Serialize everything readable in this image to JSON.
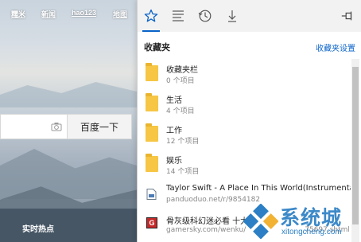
{
  "page": {
    "nav": [
      "糯米",
      "新闻",
      "hao123",
      "地图"
    ],
    "search_button": "百度一下",
    "hot_label": "实时热点"
  },
  "hub": {
    "tabs": [
      {
        "name": "favorites",
        "icon": "star-icon",
        "active": true
      },
      {
        "name": "reading-list",
        "icon": "reading-list-icon",
        "active": false
      },
      {
        "name": "history",
        "icon": "history-icon",
        "active": false
      },
      {
        "name": "downloads",
        "icon": "download-icon",
        "active": false
      }
    ],
    "pin_icon": "pin-icon",
    "title": "收藏夹",
    "settings_link": "收藏夹设置",
    "items": [
      {
        "type": "folder",
        "title": "收藏夹栏",
        "subtitle": "0 个项目"
      },
      {
        "type": "folder",
        "title": "生活",
        "subtitle": "4 个项目"
      },
      {
        "type": "folder",
        "title": "工作",
        "subtitle": "12 个项目"
      },
      {
        "type": "folder",
        "title": "娱乐",
        "subtitle": "14 个项目"
      },
      {
        "type": "link",
        "icon": "page-icon",
        "title": "Taylor Swift - A Place In This World(Instrumental).mp",
        "subtitle": "panduoduo.net/r/9854182"
      },
      {
        "type": "link",
        "icon": "game-site-icon",
        "title": "骨灰级科幻迷必看 十大",
        "subtitle": "gamersky.com/wenku/",
        "suffix": "75697.shtml"
      }
    ]
  },
  "watermark": {
    "text": "系统城",
    "url": "xitongcheng.com"
  },
  "colors": {
    "accent": "#0a63c9",
    "folder": "#f6c644",
    "watermark": "#2c7fc4"
  }
}
